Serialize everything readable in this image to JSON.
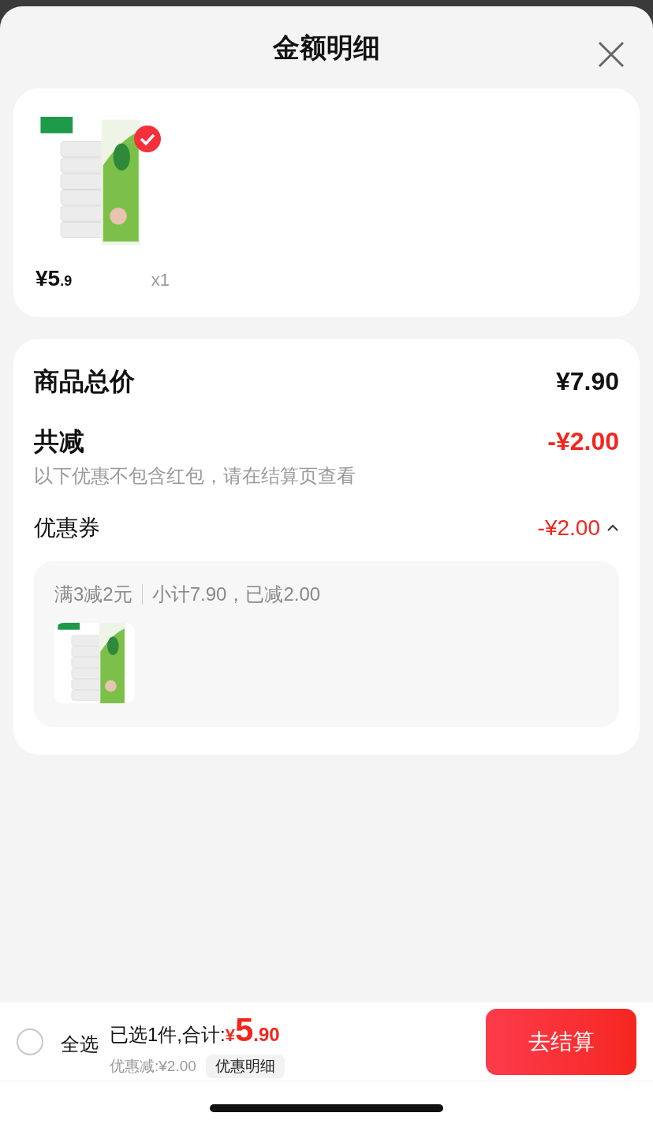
{
  "title": "金额明细",
  "items": [
    {
      "price_main": "¥5",
      "price_decimal": ".9",
      "quantity": "x1",
      "checked": true
    }
  ],
  "summary": {
    "total": {
      "label": "商品总价",
      "value": "¥7.90"
    },
    "discount": {
      "label": "共减",
      "value": "-¥2.00",
      "note": "以下优惠不包含红包，请在结算页查看"
    },
    "coupon": {
      "label": "优惠券",
      "value": "-¥2.00",
      "expanded": true,
      "rule": "满3减2元",
      "subtotal": "小计7.90，已减2.00"
    }
  },
  "footer": {
    "select_all": {
      "label": "全选",
      "checked": false
    },
    "selected_text": "已选1件,合计:",
    "currency": "¥",
    "total_main": "5",
    "total_decimal": ".90",
    "discount_text": "优惠减:¥2.00",
    "detail_button": "优惠明细",
    "checkout": "去结算"
  }
}
